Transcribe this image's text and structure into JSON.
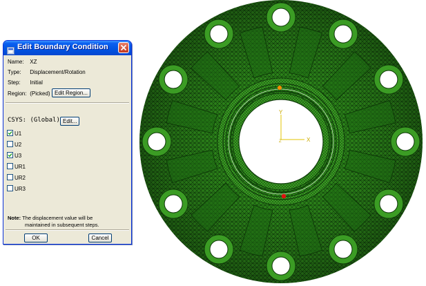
{
  "dialog": {
    "title": "Edit Boundary Condition",
    "name_label": "Name:",
    "name_value": "XZ",
    "type_label": "Type:",
    "type_value": "Displacement/Rotation",
    "step_label": "Step:",
    "step_value": "Initial",
    "region_label": "Region:",
    "region_value": "(Picked)",
    "edit_region_label": "Edit Region...",
    "csys_label": "CSYS:",
    "csys_value": "(Global)",
    "csys_edit_label": "Edit...",
    "dofs": [
      {
        "label": "U1",
        "checked": true
      },
      {
        "label": "U2",
        "checked": false
      },
      {
        "label": "U3",
        "checked": true
      },
      {
        "label": "UR1",
        "checked": false
      },
      {
        "label": "UR2",
        "checked": false
      },
      {
        "label": "UR3",
        "checked": false
      }
    ],
    "note_label": "Note:",
    "note_line1": "The displacement value will be",
    "note_line2": "maintained in subsequent steps.",
    "ok_label": "OK",
    "cancel_label": "Cancel"
  },
  "viewport": {
    "axis_y_label": "Y",
    "axis_x_label": "X",
    "axis_z_label": "Z",
    "mesh_color": "#2f8a1c",
    "point_colors": [
      "#ff8a00",
      "#e01010"
    ]
  }
}
